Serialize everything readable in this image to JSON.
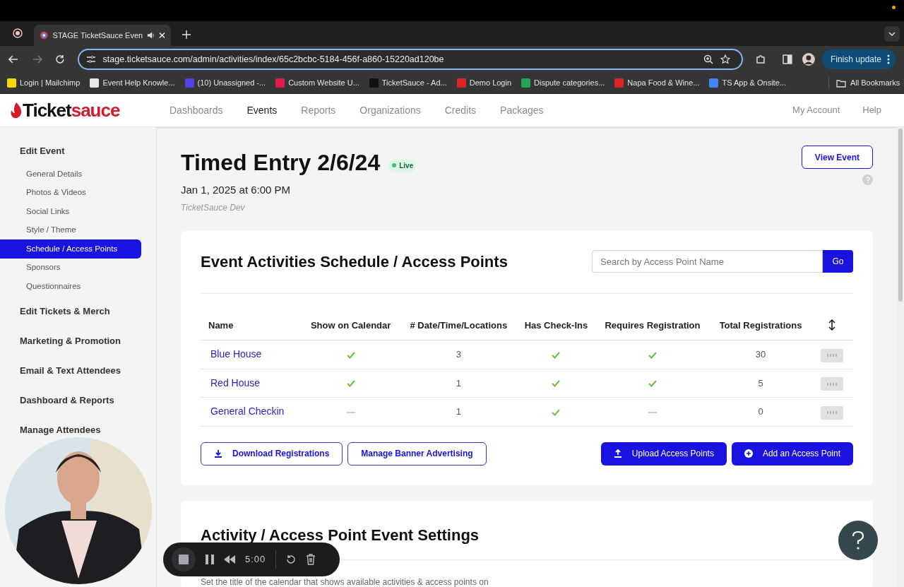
{
  "browser": {
    "tabs": [
      {
        "title": "STAGE TicketSauce Even",
        "selected": true,
        "audio": true
      }
    ],
    "url": "stage.ticketsauce.com/admin/activities/index/65c2bcbc-5184-456f-a860-15220ad120be",
    "update_button": "Finish update",
    "bookmarks": [
      {
        "label": "Login | Mailchimp",
        "color": "#f5d90a"
      },
      {
        "label": "Event Help Knowle...",
        "color": "#e5e7eb"
      },
      {
        "label": "(10) Unassigned -...",
        "color": "#4f46e5"
      },
      {
        "label": "Custom Website U...",
        "color": "#e11d48"
      },
      {
        "label": "TicketSauce - Ad...",
        "color": "#111111"
      },
      {
        "label": "Demo Login",
        "color": "#dc2626"
      },
      {
        "label": "Dispute categories...",
        "color": "#22a35a"
      },
      {
        "label": "Napa Food & Wine...",
        "color": "#dc2626"
      },
      {
        "label": "TS App & Onsite...",
        "color": "#4285f4"
      }
    ],
    "all_bookmarks": "All Bookmarks"
  },
  "app": {
    "logo_dark": "Ticket",
    "logo_red": "sauce",
    "nav": [
      {
        "label": "Dashboards",
        "selected": false
      },
      {
        "label": "Events",
        "selected": true
      },
      {
        "label": "Reports",
        "selected": false
      },
      {
        "label": "Organizations",
        "selected": false
      },
      {
        "label": "Credits",
        "selected": false
      },
      {
        "label": "Packages",
        "selected": false
      }
    ],
    "account": [
      "My Account",
      "Help"
    ]
  },
  "sidebar": [
    {
      "label": "Edit Event",
      "children": [
        {
          "label": "General Details",
          "selected": false
        },
        {
          "label": "Photos & Videos",
          "selected": false
        },
        {
          "label": "Social Links",
          "selected": false
        },
        {
          "label": "Style / Theme",
          "selected": false
        },
        {
          "label": "Schedule / Access Points",
          "selected": true
        },
        {
          "label": "Sponsors",
          "selected": false
        },
        {
          "label": "Questionnaires",
          "selected": false
        }
      ]
    },
    {
      "label": "Edit Tickets & Merch"
    },
    {
      "label": "Marketing & Promotion"
    },
    {
      "label": "Email & Text Attendees"
    },
    {
      "label": "Dashboard & Reports"
    },
    {
      "label": "Manage Attendees"
    }
  ],
  "event": {
    "title": "Timed Entry 2/6/24",
    "status": "Live",
    "date": "Jan 1, 2025 at 6:00 PM",
    "organization": "TicketSauce Dev",
    "view_button": "View Event"
  },
  "schedule": {
    "title": "Event Activities Schedule / Access Points",
    "search": {
      "placeholder": "Search by Access Point Name"
    },
    "go_button": "Go",
    "columns": [
      "Name",
      "Show on Calendar",
      "# Date/Time/Locations",
      "Has Check-Ins",
      "Requires Registration",
      "Total Registrations"
    ],
    "rows": [
      {
        "name": "Blue House",
        "show_on_calendar": true,
        "locations": "3",
        "has_checkins": true,
        "requires_registration": true,
        "total": "30"
      },
      {
        "name": "Red House",
        "show_on_calendar": true,
        "locations": "1",
        "has_checkins": true,
        "requires_registration": true,
        "total": "5"
      },
      {
        "name": "General Checkin",
        "show_on_calendar": false,
        "locations": "1",
        "has_checkins": true,
        "requires_registration": false,
        "total": "0"
      }
    ],
    "buttons": [
      {
        "label": "Download Registrations",
        "kind": "outline"
      },
      {
        "label": "Manage Banner Advertising",
        "kind": "outline"
      },
      {
        "label": "Upload Access Points",
        "kind": "solid"
      },
      {
        "label": "Add an Access Point",
        "kind": "solid"
      }
    ]
  },
  "settings": {
    "title": "Activity / Access Point Event Settings",
    "description": "Set the title of the calendar that shows available activities & access points on"
  },
  "recorder": {
    "time": "5:00"
  }
}
